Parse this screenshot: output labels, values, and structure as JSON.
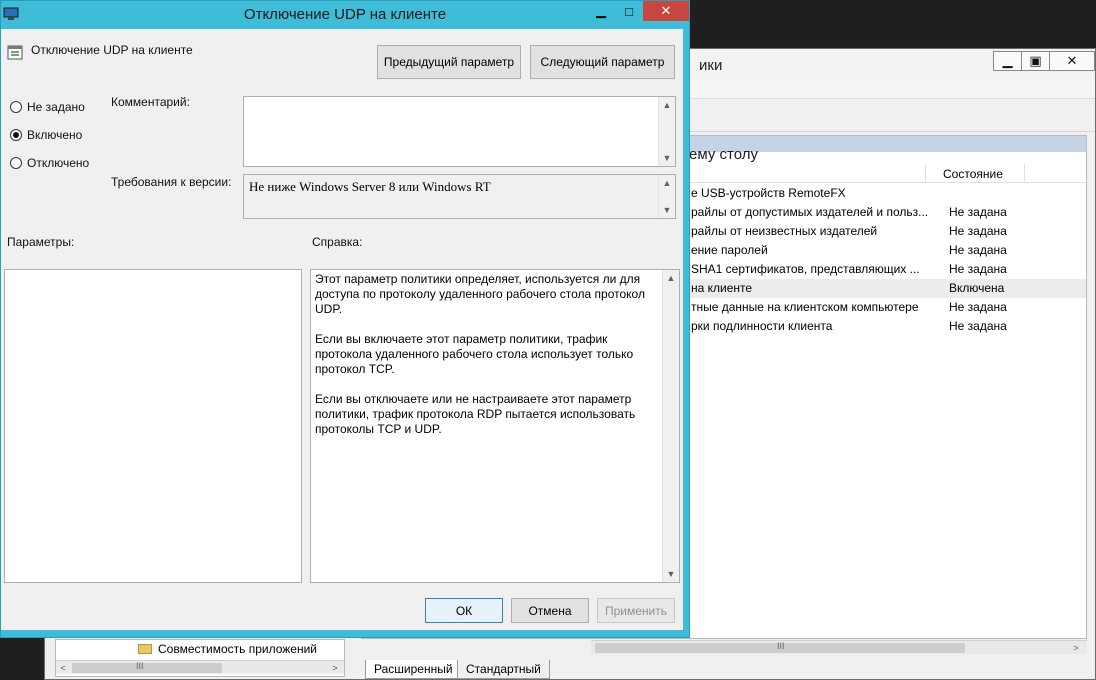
{
  "background_window": {
    "title_fragment": "ики",
    "list_header_fragment": "ему столу",
    "columns": {
      "state": "Состояние"
    },
    "rows": [
      {
        "name": "е USB-устройств RemoteFX",
        "state": ""
      },
      {
        "name": "райлы от допустимых издателей и польз...",
        "state": "Не задана"
      },
      {
        "name": "райлы от неизвестных издателей",
        "state": "Не задана"
      },
      {
        "name": "ение паролей",
        "state": "Не задана"
      },
      {
        "name": "SHA1 сертификатов, представляющих ...",
        "state": "Не задана"
      },
      {
        "name": "на клиенте",
        "state": "Включена",
        "selected": true
      },
      {
        "name": "тные данные на клиентском компьютере",
        "state": "Не задана"
      },
      {
        "name": "рки подлинности клиента",
        "state": "Не задана"
      }
    ],
    "tree_item": "Совместимость приложений",
    "tabs": [
      "Расширенный",
      "Стандартный"
    ],
    "scroll_grip": "III"
  },
  "dialog": {
    "title": "Отключение UDP на клиенте",
    "policy_name": "Отключение UDP на клиенте",
    "prev_button": "Предыдущий параметр",
    "next_button": "Следующий параметр",
    "radios": [
      {
        "label": "Не задано",
        "checked": false
      },
      {
        "label": "Включено",
        "checked": true
      },
      {
        "label": "Отключено",
        "checked": false
      }
    ],
    "comment_label": "Комментарий:",
    "comment_value": "",
    "version_label": "Требования к версии:",
    "version_value": "Не ниже Windows Server 8 или Windows RT",
    "options_label": "Параметры:",
    "help_label": "Справка:",
    "help_text": "Этот параметр политики определяет, используется ли для доступа по протоколу удаленного рабочего стола протокол UDP.\n\nЕсли вы включаете этот параметр политики, трафик протокола удаленного рабочего стола использует только протокол TCP.\n\nЕсли вы отключаете или не настраиваете этот параметр политики, трафик протокола RDP пытается использовать протоколы TCP и UDP.",
    "ok_button": "ОК",
    "cancel_button": "Отмена",
    "apply_button": "Применить",
    "accent_color": "#3fbcd7",
    "close_color": "#c7463f"
  }
}
